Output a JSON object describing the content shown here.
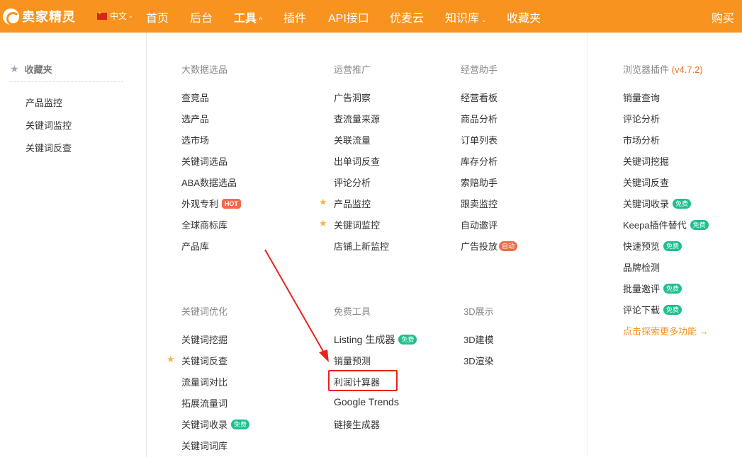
{
  "brand": {
    "name": "卖家精灵"
  },
  "nav": {
    "lang": "中文",
    "items": [
      "首页",
      "后台",
      "工具",
      "插件",
      "API接口",
      "优麦云",
      "知识库",
      "收藏夹"
    ],
    "buy": "购买"
  },
  "favorites": {
    "title": "收藏夹",
    "items": [
      "产品监控",
      "关键词监控",
      "关键词反查"
    ]
  },
  "sections": {
    "bigdata": {
      "title": "大数据选品",
      "items": [
        "查竞品",
        "选产品",
        "选市场",
        "关键词选品",
        "ABA数据选品",
        "外观专利",
        "全球商标库",
        "产品库"
      ]
    },
    "ops": {
      "title": "运营推广",
      "items": [
        "广告洞察",
        "查流量来源",
        "关联流量",
        "出单词反查",
        "评论分析",
        "产品监控",
        "关键词监控",
        "店铺上新监控"
      ]
    },
    "assist": {
      "title": "经营助手",
      "items": [
        "经营看板",
        "商品分析",
        "订单列表",
        "库存分析",
        "索赔助手",
        "跟卖监控",
        "自动邀评",
        "广告投放"
      ]
    },
    "plugin": {
      "title": "浏览器插件",
      "version": "(v4.7.2)",
      "items": [
        "销量查询",
        "评论分析",
        "市场分析",
        "关键词挖掘",
        "关键词反查",
        "关键词收录",
        "Keepa插件替代",
        "快速预览",
        "品牌检测",
        "批量邀评",
        "评论下载"
      ],
      "more": "点击探索更多功能 →"
    },
    "keyword": {
      "title": "关键词优化",
      "items": [
        "关键词挖掘",
        "关键词反查",
        "流量词对比",
        "拓展流量词",
        "关键词收录",
        "关键词词库"
      ]
    },
    "free": {
      "title": "免费工具",
      "items": [
        "Listing 生成器",
        "销量预测",
        "利润计算器",
        "Google Trends",
        "链接生成器"
      ]
    },
    "threed": {
      "title": "3D展示",
      "items": [
        "3D建模",
        "3D渲染"
      ]
    }
  },
  "badges": {
    "hot": "HOT",
    "free": "免费",
    "auto": "自动"
  },
  "colors": {
    "brand": "#f7931e",
    "badge_free": "#1fbf8f",
    "badge_hot": "#f26b4a",
    "annotation": "#e8231b"
  }
}
